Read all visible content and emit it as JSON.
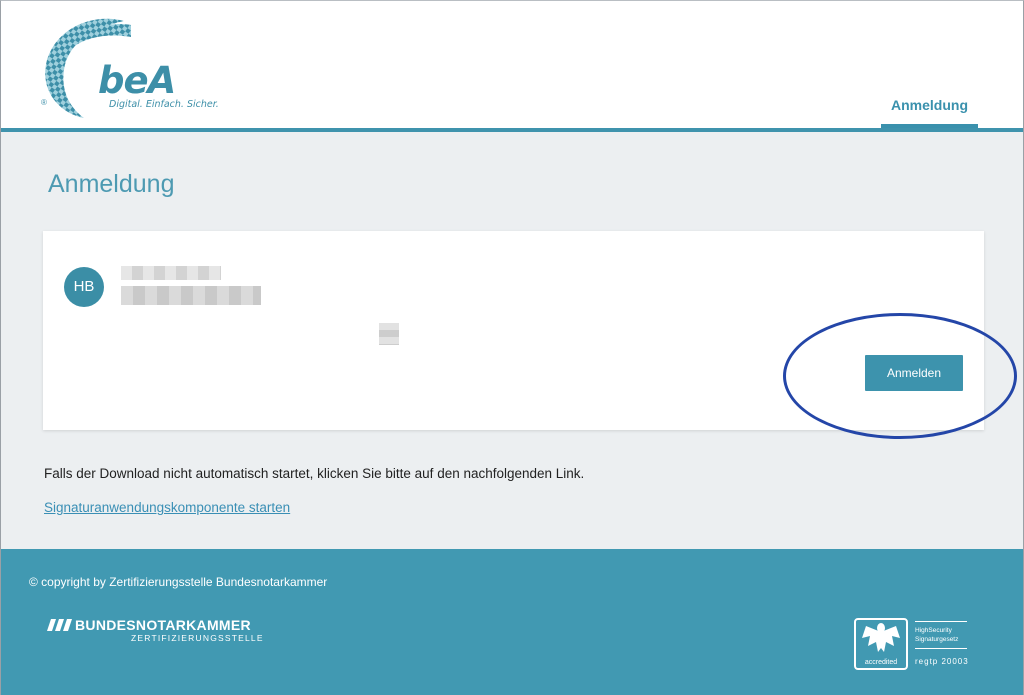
{
  "header": {
    "logo_text": "beA",
    "logo_tagline": "Digital. Einfach. Sicher.",
    "logo_reg": "®",
    "nav_tab": "Anmeldung"
  },
  "main": {
    "page_title": "Anmeldung",
    "card": {
      "avatar_initials": "HB",
      "login_button": "Anmelden"
    },
    "info_text": "Falls der Download nicht automatisch startet, klicken Sie bitte auf den nachfolgenden Link.",
    "start_link": "Signaturanwendungskomponente starten"
  },
  "footer": {
    "copyright": "© copyright by Zertifizierungsstelle Bundesnotarkammer",
    "org_name": "BUNDESNOTARKAMMER",
    "org_sub": "ZERTIFIZIERUNGSSTELLE",
    "seal_label": "accredited",
    "seal_line1": "HighSecurity",
    "seal_line2": "Signaturgesetz",
    "seal_reg": "regtp 20003"
  },
  "colors": {
    "accent": "#3f93ad",
    "highlight": "#2446a8"
  }
}
